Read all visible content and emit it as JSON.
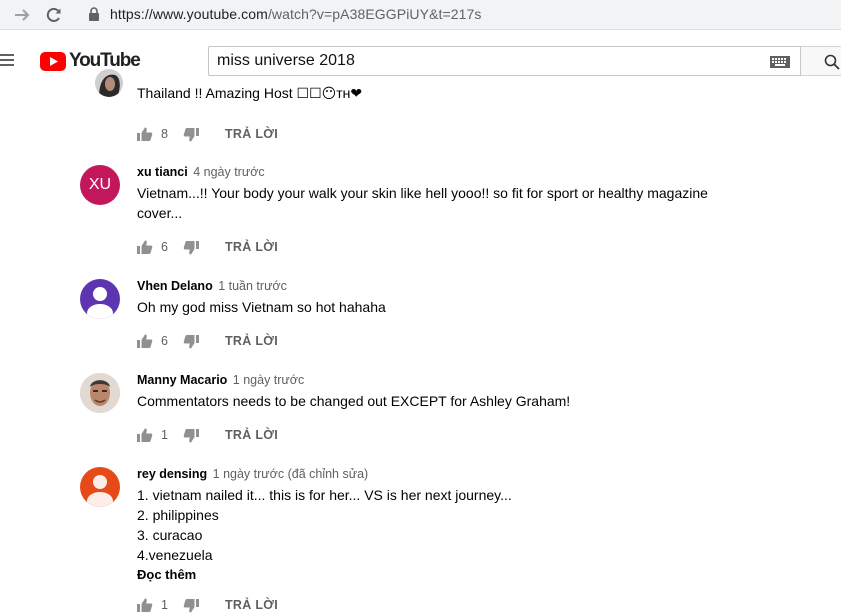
{
  "browser": {
    "url_main": "https://www.youtube.com",
    "url_rest": "/watch?v=pA38EGGPiUY&t=217s"
  },
  "header": {
    "logo_text": "YouTube",
    "search_value": "miss universe 2018"
  },
  "comments": [
    {
      "author": "",
      "time": "",
      "text": "Thailand !! Amazing Host ☐☐😶ᴛʜ❤",
      "likes": "8",
      "reply_label": "TRẢ LỜI",
      "avatar_type": "photo-dark"
    },
    {
      "author": "xu tianci",
      "time": "4 ngày trước",
      "text": "Vietnam...!!  Your body your walk your skin like hell yooo!! so fit for sport or healthy magazine cover...",
      "likes": "6",
      "reply_label": "TRẢ LỜI",
      "avatar_initials": "XU",
      "avatar_color": "#c2185b",
      "avatar_type": "initials"
    },
    {
      "author": "Vhen Delano",
      "time": "1 tuần trước",
      "text": "Oh my god miss Vietnam so hot hahaha",
      "likes": "6",
      "reply_label": "TRẢ LỜI",
      "avatar_color": "#5e35b1",
      "avatar_type": "default-person"
    },
    {
      "author": "Manny Macario",
      "time": "1 ngày trước",
      "text": "Commentators needs to be changed out EXCEPT for Ashley Graham!",
      "likes": "1",
      "reply_label": "TRẢ LỜI",
      "avatar_type": "photo-face"
    },
    {
      "author": "rey densing",
      "time": "1 ngày trước (đã chỉnh sửa)",
      "text_lines": [
        "1. vietnam nailed it... this is for her... VS is her next journey...",
        "2. philippines",
        "3. curacao",
        "4.venezuela"
      ],
      "read_more": "Đọc thêm",
      "likes": "1",
      "reply_label": "TRẢ LỜI",
      "avatar_color": "#e64a19",
      "avatar_type": "default-person"
    }
  ],
  "colors": {
    "brand_red": "#ff0000",
    "meta_gray": "#606060"
  }
}
